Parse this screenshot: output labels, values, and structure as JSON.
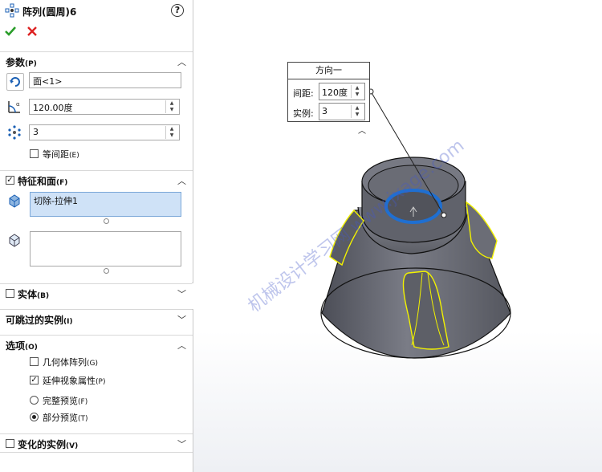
{
  "panel": {
    "title": "阵列(圆周)6",
    "help_icon": "?",
    "ok_icon": "check-icon",
    "cancel_icon": "x-icon",
    "params": {
      "header": "参数",
      "header_key": "(P)",
      "direction_value": "面<1>",
      "angle_value": "120.00度",
      "count_value": "3",
      "equal_spacing_label": "等间距",
      "equal_spacing_key": "(E)"
    },
    "features": {
      "header": "特征和面",
      "header_key": "(F)",
      "feature_item": "切除-拉伸1"
    },
    "bodies": {
      "header": "实体",
      "header_key": "(B)"
    },
    "skip": {
      "header": "可跳过的实例",
      "header_key": "(I)"
    },
    "options": {
      "header": "选项",
      "header_key": "(O)",
      "geometry_pattern_label": "几何体阵列",
      "geometry_pattern_key": "(G)",
      "propagate_label": "延伸视象属性",
      "propagate_key": "(P)",
      "full_preview_label": "完整预览",
      "full_preview_key": "(F)",
      "partial_preview_label": "部分预览",
      "partial_preview_key": "(T)"
    },
    "vary": {
      "header": "变化的实例",
      "header_key": "(V)"
    }
  },
  "callout": {
    "title": "方向一",
    "spacing_label": "间距:",
    "spacing_value": "120度",
    "instances_label": "实例:",
    "instances_value": "3"
  },
  "watermark": "机械设计学习网 www.jxage.com",
  "colors": {
    "accent_blue": "#1f6fd1",
    "selection": "#cfe2f7",
    "model": "#6d6f78",
    "highlight": "#f2f200"
  }
}
